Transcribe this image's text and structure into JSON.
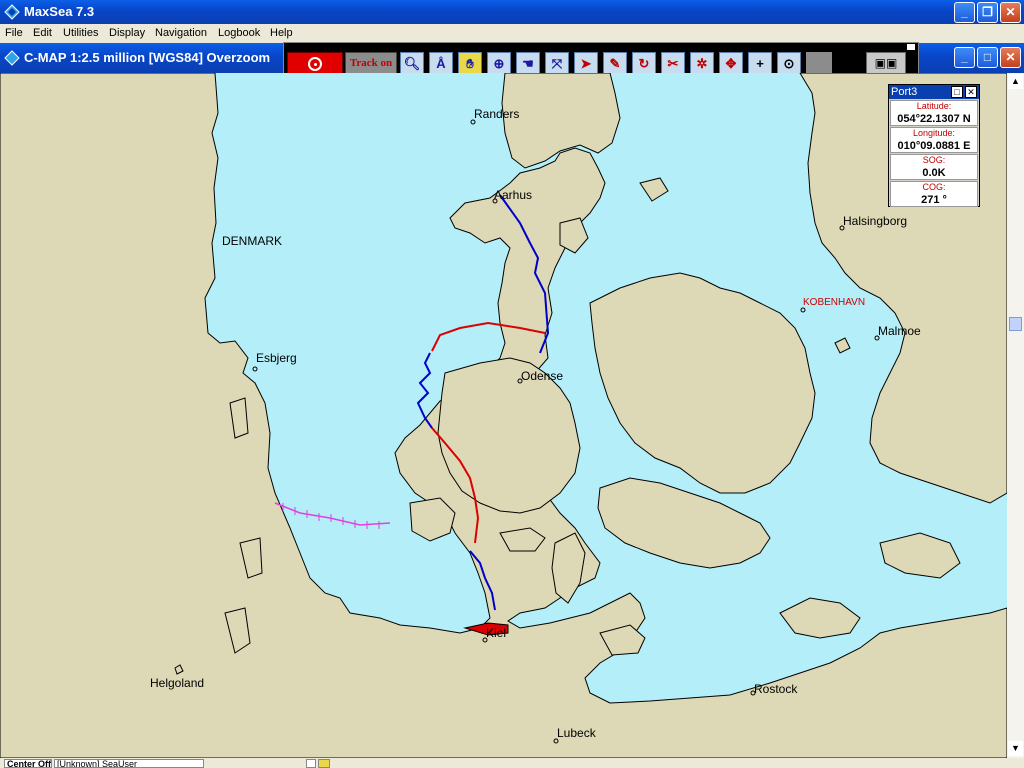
{
  "app": {
    "title": "MaxSea 7.3",
    "window_buttons": {
      "minimize": "_",
      "maximize": "❐",
      "close": "✕"
    }
  },
  "menu": [
    "File",
    "Edit",
    "Utilities",
    "Display",
    "Navigation",
    "Logbook",
    "Help"
  ],
  "child_window": {
    "title": "C-MAP  1:2.5 million [WGS84]    Overzoom",
    "buttons": {
      "minimize": "_",
      "maximize": "□",
      "close": "✕"
    }
  },
  "toolbar": {
    "track_label": "Track on",
    "icons": [
      "zoom-icon",
      "compass-divider-icon",
      "hand-pan-icon",
      "crosshair-icon",
      "grab-icon",
      "route-icon",
      "pointer-arrow-icon",
      "pencil-icon",
      "rotate-icon",
      "scissors-icon",
      "target-star-icon",
      "move-arrows-icon",
      "plus-icon",
      "center-dot-icon"
    ]
  },
  "map": {
    "colors": {
      "sea": "#B3EEF9",
      "land": "#DDD8B5",
      "coast": "#000000",
      "route_planned": "#0000CC",
      "route_track": "#DD0000",
      "border": "#E040E0",
      "boat": "#DD0000"
    },
    "places": [
      {
        "name": "Randers",
        "type": "town"
      },
      {
        "name": "Aarhus",
        "type": "town"
      },
      {
        "name": "DENMARK",
        "type": "country"
      },
      {
        "name": "Halsingborg",
        "type": "town"
      },
      {
        "name": "KOBENHAVN",
        "type": "capital"
      },
      {
        "name": "Malmoe",
        "type": "town"
      },
      {
        "name": "Esbjerg",
        "type": "town"
      },
      {
        "name": "Odense",
        "type": "town"
      },
      {
        "name": "Kiel",
        "type": "town"
      },
      {
        "name": "Helgoland",
        "type": "town"
      },
      {
        "name": "Rostock",
        "type": "town"
      },
      {
        "name": "Lubeck",
        "type": "town"
      }
    ]
  },
  "nav_panel": {
    "title": "Port3",
    "fields": [
      {
        "label": "Latitude:",
        "value": "054°22.1307 N"
      },
      {
        "label": "Longitude:",
        "value": "010°09.0881 E"
      },
      {
        "label": "SOG:",
        "value": "0.0K"
      },
      {
        "label": "COG:",
        "value": "271 °"
      }
    ]
  },
  "status": {
    "center": "Center Off",
    "user": "[Unknown] SeaUser"
  }
}
